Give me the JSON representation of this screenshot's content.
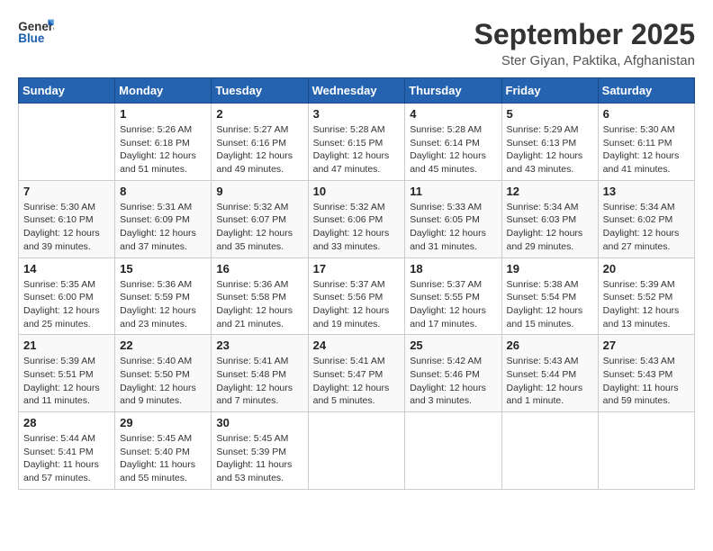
{
  "logo": {
    "general": "General",
    "blue": "Blue"
  },
  "title": "September 2025",
  "subtitle": "Ster Giyan, Paktika, Afghanistan",
  "days_of_week": [
    "Sunday",
    "Monday",
    "Tuesday",
    "Wednesday",
    "Thursday",
    "Friday",
    "Saturday"
  ],
  "weeks": [
    [
      {
        "day": "",
        "info": ""
      },
      {
        "day": "1",
        "info": "Sunrise: 5:26 AM\nSunset: 6:18 PM\nDaylight: 12 hours\nand 51 minutes."
      },
      {
        "day": "2",
        "info": "Sunrise: 5:27 AM\nSunset: 6:16 PM\nDaylight: 12 hours\nand 49 minutes."
      },
      {
        "day": "3",
        "info": "Sunrise: 5:28 AM\nSunset: 6:15 PM\nDaylight: 12 hours\nand 47 minutes."
      },
      {
        "day": "4",
        "info": "Sunrise: 5:28 AM\nSunset: 6:14 PM\nDaylight: 12 hours\nand 45 minutes."
      },
      {
        "day": "5",
        "info": "Sunrise: 5:29 AM\nSunset: 6:13 PM\nDaylight: 12 hours\nand 43 minutes."
      },
      {
        "day": "6",
        "info": "Sunrise: 5:30 AM\nSunset: 6:11 PM\nDaylight: 12 hours\nand 41 minutes."
      }
    ],
    [
      {
        "day": "7",
        "info": "Sunrise: 5:30 AM\nSunset: 6:10 PM\nDaylight: 12 hours\nand 39 minutes."
      },
      {
        "day": "8",
        "info": "Sunrise: 5:31 AM\nSunset: 6:09 PM\nDaylight: 12 hours\nand 37 minutes."
      },
      {
        "day": "9",
        "info": "Sunrise: 5:32 AM\nSunset: 6:07 PM\nDaylight: 12 hours\nand 35 minutes."
      },
      {
        "day": "10",
        "info": "Sunrise: 5:32 AM\nSunset: 6:06 PM\nDaylight: 12 hours\nand 33 minutes."
      },
      {
        "day": "11",
        "info": "Sunrise: 5:33 AM\nSunset: 6:05 PM\nDaylight: 12 hours\nand 31 minutes."
      },
      {
        "day": "12",
        "info": "Sunrise: 5:34 AM\nSunset: 6:03 PM\nDaylight: 12 hours\nand 29 minutes."
      },
      {
        "day": "13",
        "info": "Sunrise: 5:34 AM\nSunset: 6:02 PM\nDaylight: 12 hours\nand 27 minutes."
      }
    ],
    [
      {
        "day": "14",
        "info": "Sunrise: 5:35 AM\nSunset: 6:00 PM\nDaylight: 12 hours\nand 25 minutes."
      },
      {
        "day": "15",
        "info": "Sunrise: 5:36 AM\nSunset: 5:59 PM\nDaylight: 12 hours\nand 23 minutes."
      },
      {
        "day": "16",
        "info": "Sunrise: 5:36 AM\nSunset: 5:58 PM\nDaylight: 12 hours\nand 21 minutes."
      },
      {
        "day": "17",
        "info": "Sunrise: 5:37 AM\nSunset: 5:56 PM\nDaylight: 12 hours\nand 19 minutes."
      },
      {
        "day": "18",
        "info": "Sunrise: 5:37 AM\nSunset: 5:55 PM\nDaylight: 12 hours\nand 17 minutes."
      },
      {
        "day": "19",
        "info": "Sunrise: 5:38 AM\nSunset: 5:54 PM\nDaylight: 12 hours\nand 15 minutes."
      },
      {
        "day": "20",
        "info": "Sunrise: 5:39 AM\nSunset: 5:52 PM\nDaylight: 12 hours\nand 13 minutes."
      }
    ],
    [
      {
        "day": "21",
        "info": "Sunrise: 5:39 AM\nSunset: 5:51 PM\nDaylight: 12 hours\nand 11 minutes."
      },
      {
        "day": "22",
        "info": "Sunrise: 5:40 AM\nSunset: 5:50 PM\nDaylight: 12 hours\nand 9 minutes."
      },
      {
        "day": "23",
        "info": "Sunrise: 5:41 AM\nSunset: 5:48 PM\nDaylight: 12 hours\nand 7 minutes."
      },
      {
        "day": "24",
        "info": "Sunrise: 5:41 AM\nSunset: 5:47 PM\nDaylight: 12 hours\nand 5 minutes."
      },
      {
        "day": "25",
        "info": "Sunrise: 5:42 AM\nSunset: 5:46 PM\nDaylight: 12 hours\nand 3 minutes."
      },
      {
        "day": "26",
        "info": "Sunrise: 5:43 AM\nSunset: 5:44 PM\nDaylight: 12 hours\nand 1 minute."
      },
      {
        "day": "27",
        "info": "Sunrise: 5:43 AM\nSunset: 5:43 PM\nDaylight: 11 hours\nand 59 minutes."
      }
    ],
    [
      {
        "day": "28",
        "info": "Sunrise: 5:44 AM\nSunset: 5:41 PM\nDaylight: 11 hours\nand 57 minutes."
      },
      {
        "day": "29",
        "info": "Sunrise: 5:45 AM\nSunset: 5:40 PM\nDaylight: 11 hours\nand 55 minutes."
      },
      {
        "day": "30",
        "info": "Sunrise: 5:45 AM\nSunset: 5:39 PM\nDaylight: 11 hours\nand 53 minutes."
      },
      {
        "day": "",
        "info": ""
      },
      {
        "day": "",
        "info": ""
      },
      {
        "day": "",
        "info": ""
      },
      {
        "day": "",
        "info": ""
      }
    ]
  ]
}
